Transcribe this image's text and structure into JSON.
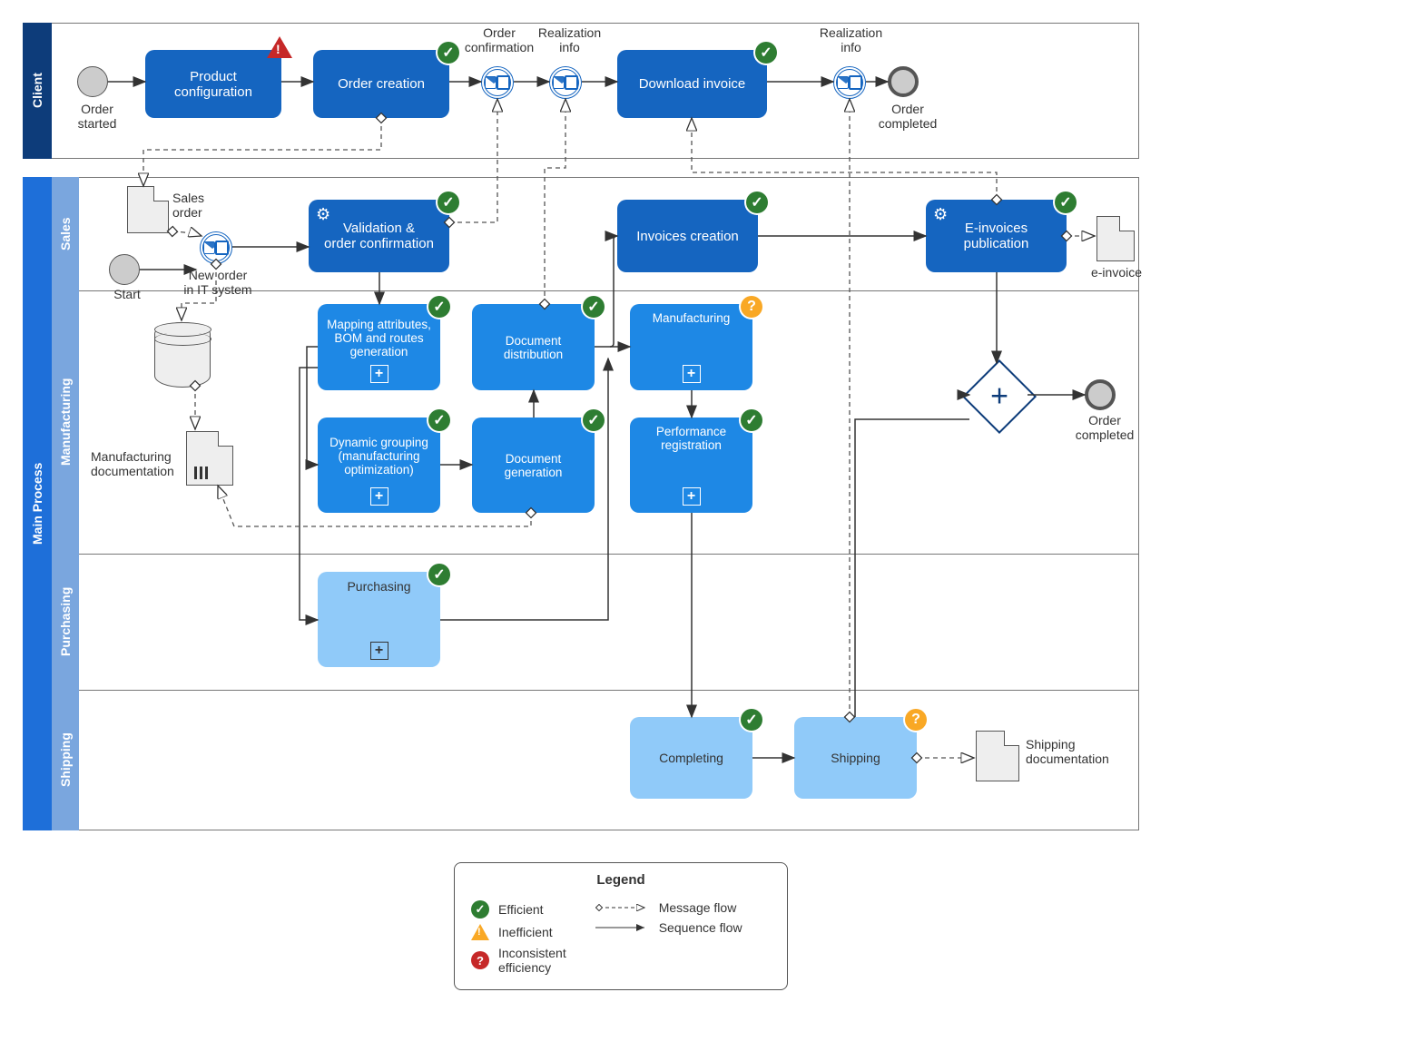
{
  "pools": {
    "client": "Client",
    "main": "Main Process"
  },
  "lanes": {
    "sales": "Sales",
    "manufacturing": "Manufacturing",
    "purchasing": "Purchasing",
    "shipping": "Shipping"
  },
  "events": {
    "order_started": "Order\nstarted",
    "order_completed_client": "Order\ncompleted",
    "start": "Start",
    "order_completed_main": "Order\ncompleted",
    "order_confirmation": "Order\nconfirmation",
    "realization_info1": "Realization\ninfo",
    "realization_info2": "Realization\ninfo",
    "new_order": "New order\nin IT system"
  },
  "tasks": {
    "product_config": "Product\nconfiguration",
    "order_creation": "Order creation",
    "download_invoice": "Download invoice",
    "validation": "Validation &\norder confirmation",
    "invoices_creation": "Invoices creation",
    "einvoices": "E-invoices\npublication",
    "mapping": "Mapping attributes,\nBOM and routes\ngeneration",
    "doc_distribution": "Document\ndistribution",
    "manufacturing": "Manufacturing",
    "dynamic_grouping": "Dynamic grouping\n(manufacturing\noptimization)",
    "doc_generation": "Document\ngeneration",
    "performance_reg": "Performance\nregistration",
    "purchasing": "Purchasing",
    "completing": "Completing",
    "shipping_task": "Shipping"
  },
  "data_objects": {
    "sales_order": "Sales\norder",
    "manuf_doc": "Manufacturing\ndocumentation",
    "einvoice_doc": "e-invoice",
    "shipping_doc": "Shipping\ndocumentation"
  },
  "legend": {
    "title": "Legend",
    "efficient": "Efficient",
    "inefficient": "Inefficient",
    "inconsistent": "Inconsistent\nefficiency",
    "message_flow": "Message flow",
    "sequence_flow": "Sequence flow"
  },
  "badges": {
    "check": "✓",
    "question": "?"
  }
}
